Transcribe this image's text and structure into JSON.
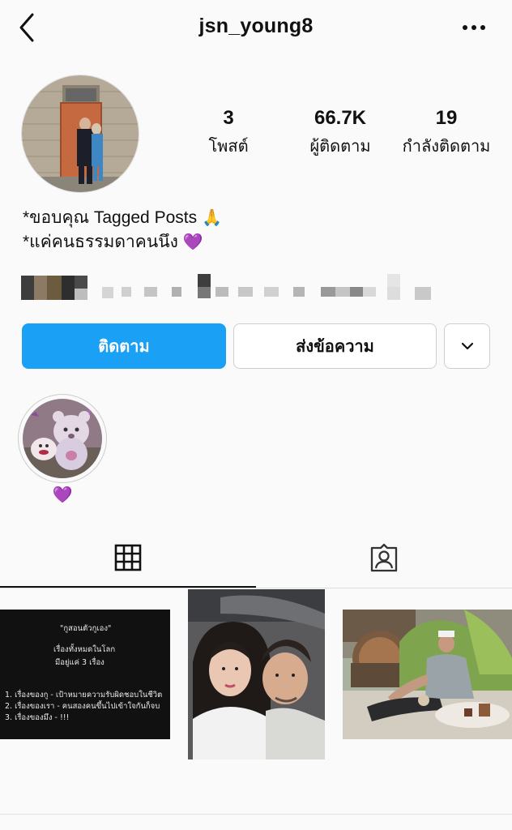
{
  "header": {
    "username": "jsn_young8",
    "back_icon": "chevron-left-icon",
    "more_icon": "more-horizontal-icon"
  },
  "profile": {
    "stats": [
      {
        "value": "3",
        "label": "โพสต์"
      },
      {
        "value": "66.7K",
        "label": "ผู้ติดตาม"
      },
      {
        "value": "19",
        "label": "กำลังติดตาม"
      }
    ],
    "bio": {
      "line1": "*ขอบคุณ Tagged Posts",
      "line1_emoji": "🙏",
      "line2": "*แค่คนธรรมดาคนนึง",
      "line2_emoji": "💜"
    }
  },
  "actions": {
    "follow_label": "ติดตาม",
    "message_label": "ส่งข้อความ",
    "follow_color": "#1aa0f5"
  },
  "highlights": [
    {
      "label": "💜"
    }
  ],
  "tabs": [
    {
      "icon": "grid-icon",
      "active": true
    },
    {
      "icon": "tagged-person-icon",
      "active": false
    }
  ],
  "posts": [
    {
      "type": "text-image",
      "lines": [
        "\"กูสอนตัวกูเอง\"",
        "เรื่องทั้งหมดในโลก",
        "มีอยู่แค่ 3 เรื่อง",
        "1. เรื่องของกู - เป้าหมายความรับผิดชอบในชีวิต",
        "2. เรื่องของเรา - คนสองคนขึ้นไปเข้าใจกันก็จบ",
        "3. เรื่องของมึง - !!!"
      ]
    },
    {
      "type": "photo",
      "subject": "couple-selfie"
    },
    {
      "type": "photo",
      "subject": "man-at-cafe"
    }
  ]
}
